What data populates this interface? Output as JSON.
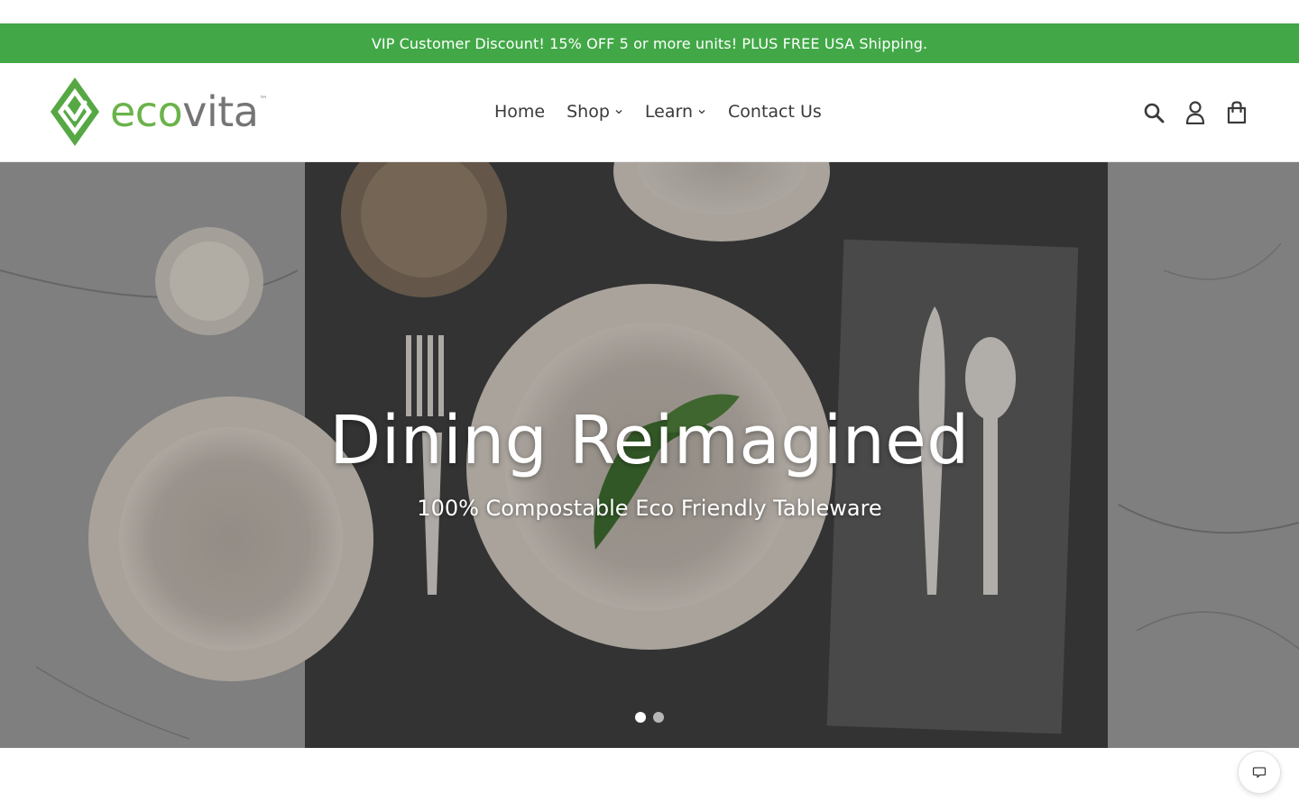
{
  "announcement": {
    "text": "VIP Customer Discount! 15% OFF 5 or more units! PLUS FREE USA Shipping."
  },
  "brand": {
    "name_part1": "eco",
    "name_part2": "vita",
    "trademark": "™",
    "colors": {
      "green": "#6ab34a",
      "gray": "#757575"
    }
  },
  "nav": {
    "items": [
      {
        "label": "Home",
        "has_dropdown": false
      },
      {
        "label": "Shop",
        "has_dropdown": true
      },
      {
        "label": "Learn",
        "has_dropdown": true
      },
      {
        "label": "Contact Us",
        "has_dropdown": false
      }
    ]
  },
  "header_icons": [
    "search-icon",
    "account-icon",
    "cart-icon"
  ],
  "hero": {
    "title": "Dining Reimagined",
    "subtitle": "100% Compostable Eco Friendly Tableware",
    "slides_total": 2,
    "active_slide": 1
  },
  "chat": {
    "icon": "chat-icon"
  },
  "colors": {
    "announcement_bg": "#42a847",
    "text": "#3a3a3a"
  }
}
